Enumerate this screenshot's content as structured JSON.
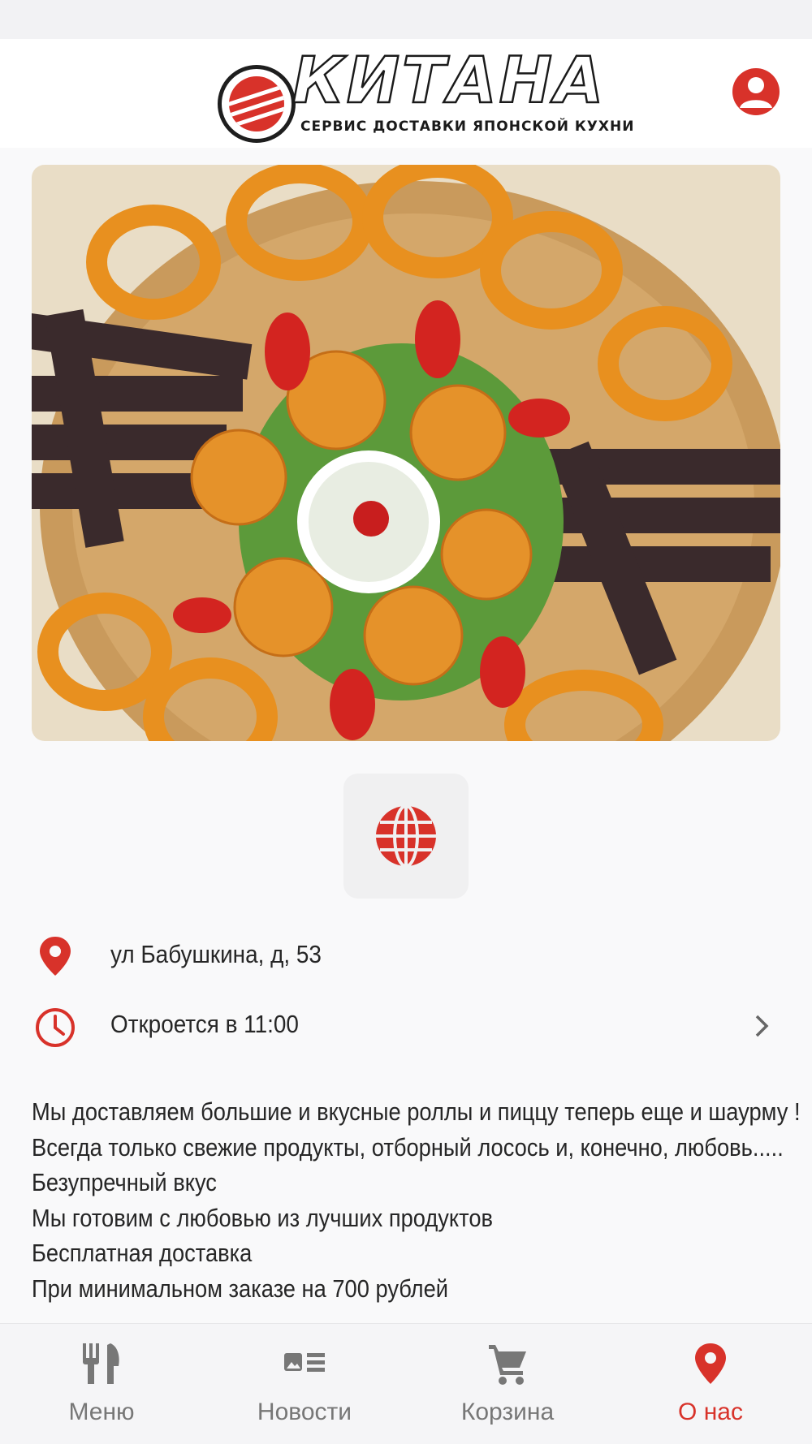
{
  "colors": {
    "accent": "#d8322a",
    "inactive": "#777777",
    "background": "#f9f9fa"
  },
  "header": {
    "logo_title": "КИТАНА",
    "logo_subtitle": "СЕРВИС ДОСТАВКИ ЯПОНСКОЙ КУХНИ",
    "profile_icon": "user-icon"
  },
  "website_button_icon": "globe-icon",
  "address": {
    "icon": "location-pin-icon",
    "text": "ул Бабушкина, д, 53"
  },
  "hours": {
    "icon": "clock-icon",
    "text": "Откроется в 11:00"
  },
  "description": [
    "Мы доставляем большие и вкусные роллы и пиццу теперь еще и шаурму !",
    "Всегда только свежие продукты, отборный лосось и, конечно, любовь.....",
    "Безупречный вкус",
    "Мы готовим с любовью из лучших продуктов",
    "Бесплатная доставка",
    "При минимальном заказе на 700 рублей"
  ],
  "tabs": [
    {
      "label": "Меню",
      "icon": "fork-knife-icon",
      "active": false
    },
    {
      "label": "Новости",
      "icon": "news-icon",
      "active": false
    },
    {
      "label": "Корзина",
      "icon": "cart-icon",
      "active": false
    },
    {
      "label": "О нас",
      "icon": "location-pin-icon",
      "active": true
    }
  ]
}
